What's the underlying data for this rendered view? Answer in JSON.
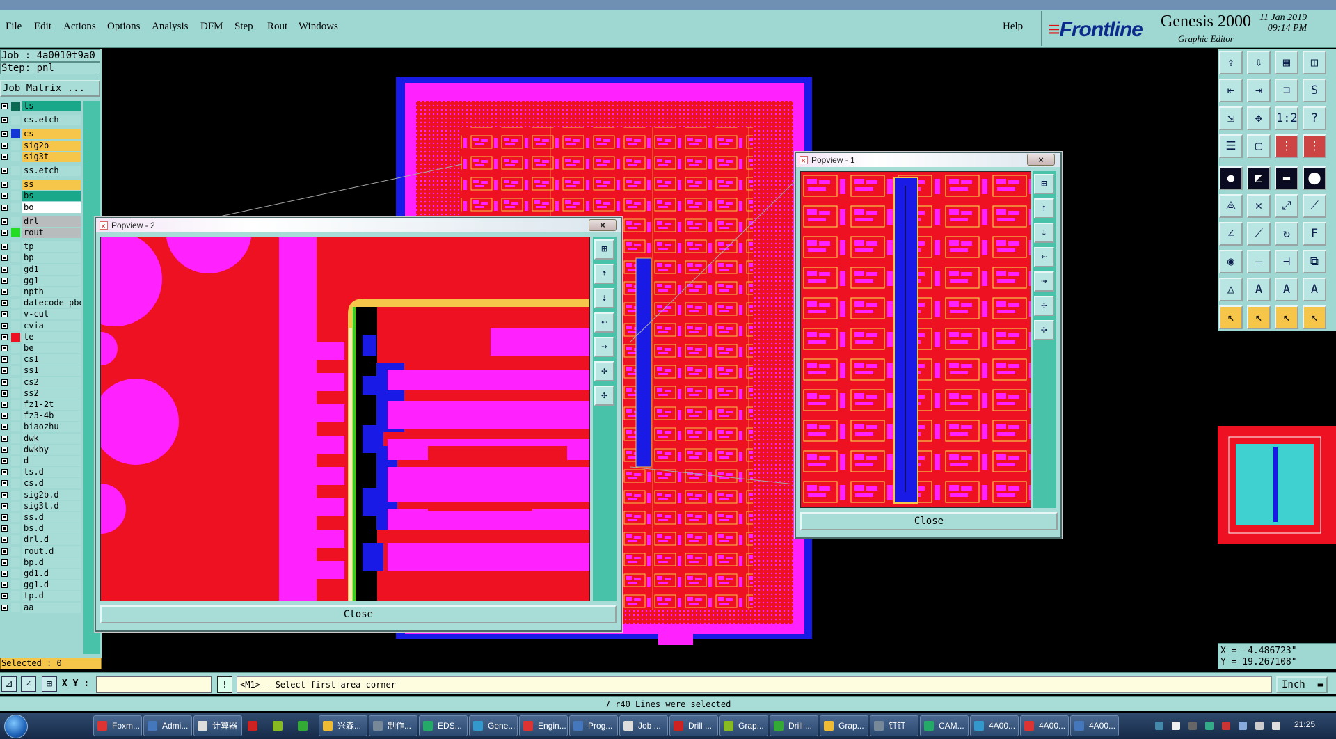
{
  "menu": {
    "items": [
      "File",
      "Edit",
      "Actions",
      "Options",
      "Analysis",
      "DFM",
      "Step",
      "Rout",
      "Windows"
    ],
    "help": "Help"
  },
  "brand": {
    "logo": "Frontline",
    "product": "Genesis 2000",
    "subtitle": "Graphic Editor",
    "date": "11 Jan 2019",
    "time": "09:14 PM"
  },
  "job": {
    "job_line": "Job : 4a0010t9a0",
    "step_line": "Step: pnl",
    "matrix_button": "Job Matrix ..."
  },
  "layers": [
    {
      "name": "ts",
      "bg": "#1aa88a",
      "swatch": "#0c6a52",
      "hl": "#1aa88a"
    },
    {
      "name": "cs.etch",
      "bg": "#a8dcd7",
      "swatch": "#a8dcd7"
    },
    {
      "name": "cs",
      "bg": "#f6c64a",
      "swatch": "#1436d6"
    },
    {
      "name": "sig2b",
      "bg": "#f6c64a",
      "swatch": "#a8dcd7"
    },
    {
      "name": "sig3t",
      "bg": "#f6c64a",
      "swatch": "#a8dcd7"
    },
    {
      "name": "ss.etch",
      "bg": "#a8dcd7",
      "swatch": "#a8dcd7"
    },
    {
      "name": "ss",
      "bg": "#f6c64a",
      "swatch": "#a8dcd7"
    },
    {
      "name": "bs",
      "bg": "#1aa88a",
      "swatch": "#a8dcd7"
    },
    {
      "name": "bo",
      "bg": "#ffffff",
      "swatch": "#a8dcd7"
    },
    {
      "name": "drl",
      "bg": "#b8bcbc",
      "swatch": "#a8dcd7"
    },
    {
      "name": "rout",
      "bg": "#b8bcbc",
      "swatch": "#22dd22"
    },
    {
      "name": "tp",
      "bg": "#a8dcd7",
      "swatch": "#a8dcd7"
    },
    {
      "name": "bp",
      "bg": "#a8dcd7",
      "swatch": "#a8dcd7"
    },
    {
      "name": "gd1",
      "bg": "#a8dcd7",
      "swatch": "#a8dcd7"
    },
    {
      "name": "gg1",
      "bg": "#a8dcd7",
      "swatch": "#a8dcd7"
    },
    {
      "name": "npth",
      "bg": "#a8dcd7",
      "swatch": "#a8dcd7"
    },
    {
      "name": "datecode-pbe",
      "bg": "#a8dcd7",
      "swatch": "#a8dcd7"
    },
    {
      "name": "v-cut",
      "bg": "#a8dcd7",
      "swatch": "#a8dcd7"
    },
    {
      "name": "cvia",
      "bg": "#a8dcd7",
      "swatch": "#a8dcd7"
    },
    {
      "name": "te",
      "bg": "#a8dcd7",
      "swatch": "#ee1122"
    },
    {
      "name": "be",
      "bg": "#a8dcd7",
      "swatch": "#a8dcd7"
    },
    {
      "name": "cs1",
      "bg": "#a8dcd7",
      "swatch": "#a8dcd7"
    },
    {
      "name": "ss1",
      "bg": "#a8dcd7",
      "swatch": "#a8dcd7"
    },
    {
      "name": "cs2",
      "bg": "#a8dcd7",
      "swatch": "#a8dcd7"
    },
    {
      "name": "ss2",
      "bg": "#a8dcd7",
      "swatch": "#a8dcd7"
    },
    {
      "name": "fz1-2t",
      "bg": "#a8dcd7",
      "swatch": "#a8dcd7"
    },
    {
      "name": "fz3-4b",
      "bg": "#a8dcd7",
      "swatch": "#a8dcd7"
    },
    {
      "name": "biaozhu",
      "bg": "#a8dcd7",
      "swatch": "#a8dcd7"
    },
    {
      "name": "dwk",
      "bg": "#a8dcd7",
      "swatch": "#a8dcd7"
    },
    {
      "name": "dwkby",
      "bg": "#a8dcd7",
      "swatch": "#a8dcd7"
    },
    {
      "name": "d",
      "bg": "#a8dcd7",
      "swatch": "#a8dcd7"
    },
    {
      "name": "ts.d",
      "bg": "#a8dcd7",
      "swatch": "#a8dcd7"
    },
    {
      "name": "cs.d",
      "bg": "#a8dcd7",
      "swatch": "#a8dcd7"
    },
    {
      "name": "sig2b.d",
      "bg": "#a8dcd7",
      "swatch": "#a8dcd7"
    },
    {
      "name": "sig3t.d",
      "bg": "#a8dcd7",
      "swatch": "#a8dcd7"
    },
    {
      "name": "ss.d",
      "bg": "#a8dcd7",
      "swatch": "#a8dcd7"
    },
    {
      "name": "bs.d",
      "bg": "#a8dcd7",
      "swatch": "#a8dcd7"
    },
    {
      "name": "drl.d",
      "bg": "#a8dcd7",
      "swatch": "#a8dcd7"
    },
    {
      "name": "rout.d",
      "bg": "#a8dcd7",
      "swatch": "#a8dcd7"
    },
    {
      "name": "bp.d",
      "bg": "#a8dcd7",
      "swatch": "#a8dcd7"
    },
    {
      "name": "gd1.d",
      "bg": "#a8dcd7",
      "swatch": "#a8dcd7"
    },
    {
      "name": "gg1.d",
      "bg": "#a8dcd7",
      "swatch": "#a8dcd7"
    },
    {
      "name": "tp.d",
      "bg": "#a8dcd7",
      "swatch": "#a8dcd7"
    },
    {
      "name": "aa",
      "bg": "#a8dcd7",
      "swatch": "#a8dcd7"
    }
  ],
  "selected": "Selected : 0",
  "command": {
    "xy_label": "X Y :",
    "xy_value": "",
    "warn": "!",
    "prompt": "<M1> - Select first area corner",
    "unit": "Inch"
  },
  "status": "7 r40 Lines were selected",
  "coords": {
    "x": "X = -4.486723\"",
    "y": "Y = 19.267108\""
  },
  "popviews": [
    {
      "title": "Popview - 2",
      "close": "Close"
    },
    {
      "title": "Popview - 1",
      "close": "Close"
    }
  ],
  "taskbar": {
    "tasks": [
      "Foxm...",
      "Admi...",
      "计算器",
      "",
      "",
      "",
      "兴森...",
      "制作...",
      "EDS...",
      "Gene...",
      "Engin...",
      "Prog...",
      "Job ...",
      "Drill ...",
      "Grap...",
      "Drill ...",
      "Grap...",
      "钉钉",
      "CAM...",
      "4A00...",
      "4A00...",
      "4A00..."
    ],
    "clock": "21:25"
  },
  "colors": {
    "panel": "#9fd8d3",
    "pcb_red": "#ee1122",
    "pcb_magenta": "#ff22ff",
    "pcb_blue": "#1a1ae6",
    "highlight": "#f6c64a"
  }
}
